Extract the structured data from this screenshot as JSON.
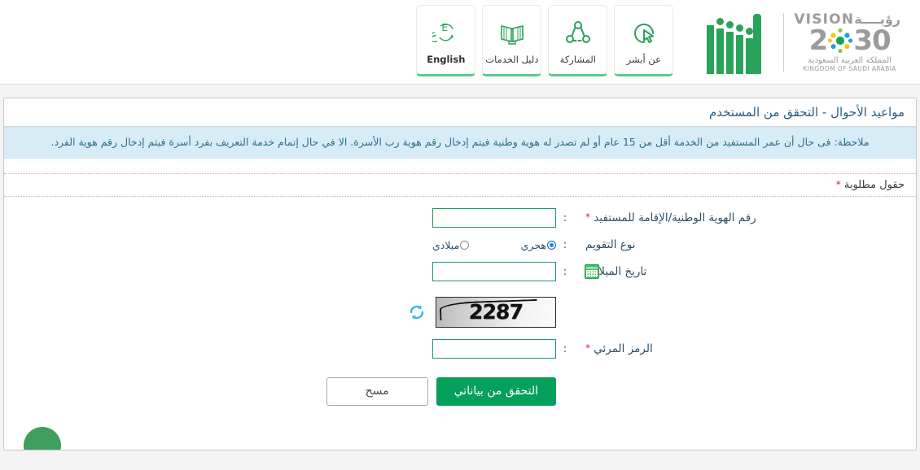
{
  "header": {
    "nav_buttons": [
      {
        "label": "عن أبشر",
        "icon": "cursor-circle-icon"
      },
      {
        "label": "المشاركة",
        "icon": "share-nodes-icon"
      },
      {
        "label": "دليل الخدمات",
        "icon": "open-book-icon"
      },
      {
        "label": "English",
        "icon": "language-switch-icon"
      }
    ],
    "vision_logo": {
      "vision_en": "VISION",
      "vision_ar": "رؤيــــة",
      "year_left": "2",
      "year_right": "30",
      "sub_ar": "المملكة العربية السعودية",
      "sub_en": "KINGDOM OF SAUDI ARABIA"
    }
  },
  "page": {
    "title": "مواعيد الأحوال - التحقق من المستخدم",
    "notice": "ملاحظة: فى حال أن عمر المستفيد من الخدمة أقل من 15 عام أو لم تصدر له هوية وطنية فيتم إدخال رقم هوية رب الأسرة. الا في حال إتمام خدمة التعريف بفرد أسرة فيتم إدخال رقم هوية الفرد.",
    "required_fields_label": "حقول مطلوبة",
    "required_marker": "*"
  },
  "form": {
    "id_field": {
      "label": "رقم الهوية الوطنية/الإقامة للمستفيد",
      "required": "*",
      "colon": ":",
      "value": "",
      "placeholder": ""
    },
    "calendar_type": {
      "label": "نوع التقويم",
      "colon": ":",
      "options": [
        {
          "label": "هجري",
          "selected": true
        },
        {
          "label": "ميلادي",
          "selected": false
        }
      ]
    },
    "birth_date": {
      "label": "تاريخ الميلاد",
      "required": "*",
      "colon": ":",
      "value": "",
      "placeholder": "",
      "icon": "calendar-icon"
    },
    "captcha": {
      "label": "الرمز المرئي",
      "required": "*",
      "colon": ":",
      "image_text": "2287",
      "refresh_icon": "refresh-icon",
      "value": "",
      "placeholder": ""
    },
    "buttons": {
      "submit": "التحقق من بياناتي",
      "clear": "مسح"
    }
  },
  "colors": {
    "brand_green": "#05a05a",
    "absher_green": "#29a35a",
    "notice_bg": "#d7ecf7",
    "notice_text": "#2d6e8e",
    "title_text": "#2b5d7d",
    "required_red": "#e02020",
    "radio_blue": "#1e7fe0",
    "refresh_cyan": "#2fb8e6"
  }
}
